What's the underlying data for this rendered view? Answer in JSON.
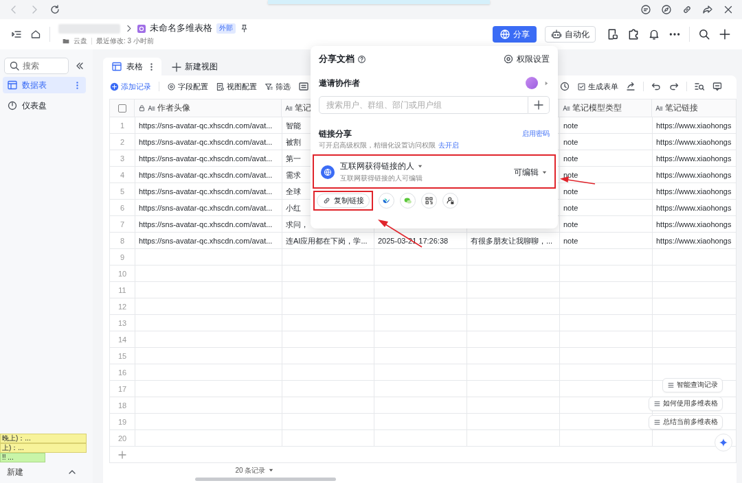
{
  "header": {
    "title": "未命名多维表格",
    "tag": "外部",
    "location": "云盘",
    "modified": "最近修改: 3 小时前",
    "share_button": "分享",
    "automation_button": "自动化"
  },
  "sidebar": {
    "search": {
      "placeholder": "搜索"
    },
    "items": [
      {
        "label": "数据表",
        "selected": true
      },
      {
        "label": "仪表盘",
        "selected": false
      }
    ],
    "new_button": "新建",
    "notes": [
      {
        "text": "晚上)：...",
        "color": "#f7f39a"
      },
      {
        "text": "上)：...",
        "color": "#f7f39a"
      },
      {
        "text": "!! ...",
        "color": "#c8f5a8"
      }
    ]
  },
  "view_tabs": [
    {
      "label": "表格",
      "selected": true
    }
  ],
  "new_view_button": "新建视图",
  "toolbar": {
    "left": [
      "添加记录",
      "字段配置",
      "视图配置",
      "筛选"
    ],
    "right": [
      "生成表单"
    ]
  },
  "table": {
    "select_all_checked": false,
    "columns": [
      {
        "label": "作者头像",
        "locked": true
      },
      {
        "label": "笔记",
        "locked": false
      },
      {},
      {},
      {
        "label": "笔记模型类型",
        "locked": false
      },
      {
        "label": "笔记链接",
        "locked": false
      }
    ],
    "rows": [
      {
        "index": "1",
        "cells": [
          "https://sns-avatar-qc.xhscdn.com/avat...",
          "智能",
          null,
          null,
          "note",
          "https://www.xiaohongs"
        ]
      },
      {
        "index": "2",
        "cells": [
          "https://sns-avatar-qc.xhscdn.com/avat...",
          "被割",
          null,
          null,
          "note",
          "https://www.xiaohongs"
        ]
      },
      {
        "index": "3",
        "cells": [
          "https://sns-avatar-qc.xhscdn.com/avat...",
          "第一",
          null,
          null,
          "note",
          "https://www.xiaohongs"
        ]
      },
      {
        "index": "4",
        "cells": [
          "https://sns-avatar-qc.xhscdn.com/avat...",
          "需求",
          null,
          null,
          "note",
          "https://www.xiaohongs"
        ]
      },
      {
        "index": "5",
        "cells": [
          "https://sns-avatar-qc.xhscdn.com/avat...",
          "全球",
          null,
          null,
          "note",
          "https://www.xiaohongs"
        ]
      },
      {
        "index": "6",
        "cells": [
          "https://sns-avatar-qc.xhscdn.com/avat...",
          "小红",
          null,
          null,
          "note",
          "https://www.xiaohongs"
        ]
      },
      {
        "index": "7",
        "cells": [
          "https://sns-avatar-qc.xhscdn.com/avat...",
          "求问，",
          null,
          null,
          "note",
          "https://www.xiaohongs"
        ]
      },
      {
        "index": "8",
        "cells": [
          "https://sns-avatar-qc.xhscdn.com/avat...",
          "连AI应用都在下岗，学...",
          "2025-03-21 17:26:38",
          "有很多朋友让我聊聊，...",
          "note",
          "https://www.xiaohongs"
        ]
      },
      {
        "index": "9"
      },
      {
        "index": "10"
      },
      {
        "index": "11"
      },
      {
        "index": "12"
      },
      {
        "index": "13"
      },
      {
        "index": "14"
      },
      {
        "index": "15"
      },
      {
        "index": "16"
      },
      {
        "index": "17"
      },
      {
        "index": "18"
      },
      {
        "index": "19"
      },
      {
        "index": "20"
      }
    ],
    "record_count": "20 条记录"
  },
  "assistant_buttons": [
    "智能查询记录",
    "如何使用多维表格",
    "总结当前多维表格"
  ],
  "share_popup": {
    "title": "分享文档",
    "permission_settings": "权限设置",
    "invite_label": "邀请协作者",
    "search": {
      "placeholder": "搜索用户、群组、部门或用户组"
    },
    "link_share_label": "链接分享",
    "enable_password": "启用密码",
    "advanced_hint": "可开启高级权限，精细化设置访问权限",
    "enable_link": "去开启",
    "scope": "互联网获得链接的人",
    "scope_desc": "互联网获得链接的人可编辑",
    "permission": "可编辑",
    "copy_link": "复制链接"
  }
}
